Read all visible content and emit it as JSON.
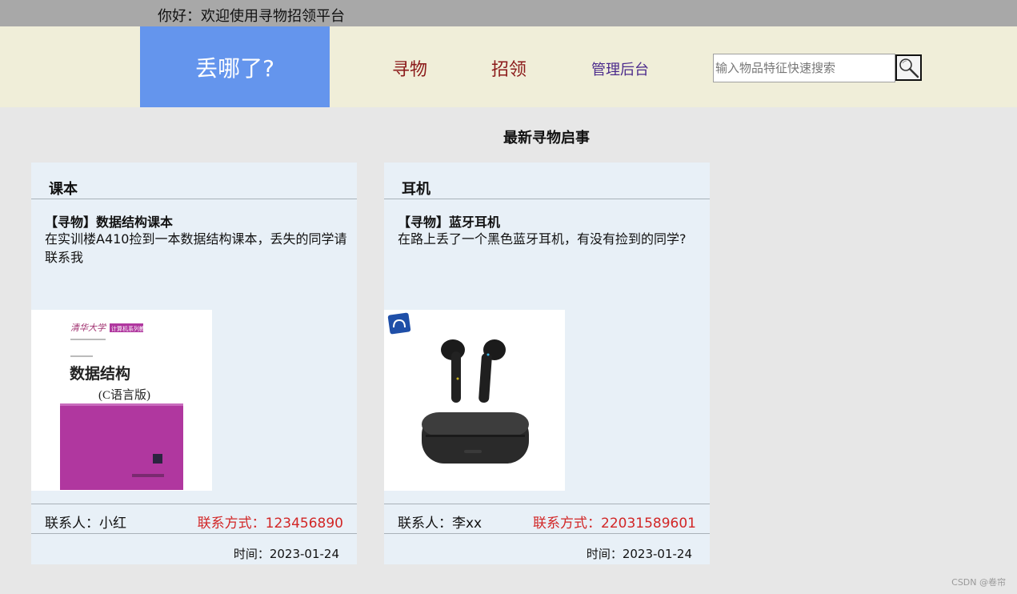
{
  "topbar": {
    "greeting": "你好：欢迎使用寻物招领平台"
  },
  "nav": {
    "logo": "丢哪了?",
    "items": [
      {
        "label": "寻物"
      },
      {
        "label": "招领"
      },
      {
        "label": "管理后台"
      }
    ],
    "search_placeholder": "输入物品特征快速搜索",
    "search_icon": "magnifier-icon"
  },
  "main": {
    "section_title": "最新寻物启事",
    "cards": [
      {
        "category": "课本",
        "title": "【寻物】数据结构课本",
        "description": "在实训楼A410捡到一本数据结构课本，丢失的同学请联系我",
        "image": {
          "publisher": "清华大学",
          "series": "计算机系列教材",
          "book_title": "数据结构",
          "edition": "(C语言版)"
        },
        "contact_person": "联系人：小红",
        "contact_phone": "联系方式：123456890",
        "time": "时间：2023-01-24"
      },
      {
        "category": "耳机",
        "title": "【寻物】蓝牙耳机",
        "description": "在路上丢了一个黑色蓝牙耳机，有没有捡到的同学?",
        "image": {},
        "contact_person": "联系人：李xx",
        "contact_phone": "联系方式：22031589601",
        "time": "时间：2023-01-24"
      }
    ]
  },
  "watermark": "CSDN @卷帘",
  "colors": {
    "topbar": "#a8a8a8",
    "navbar": "#f0eed9",
    "logo_bg": "#6495ed",
    "nav_link": "#8b1a1a",
    "admin_link": "#4b2a8c",
    "card_bg": "#e8f0f7",
    "phone": "#d22626",
    "page_bg": "#e7e7e7"
  }
}
